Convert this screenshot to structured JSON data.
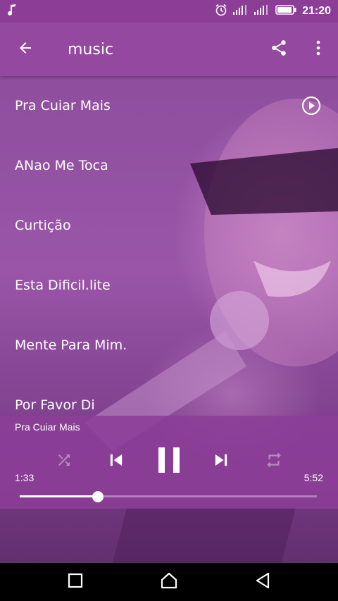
{
  "status_bar": {
    "time": "21:20",
    "icons": [
      "music-note-icon",
      "alarm-icon",
      "signal-icon",
      "signal-icon",
      "battery-icon"
    ]
  },
  "app_bar": {
    "title": "music",
    "icons": [
      "back-arrow-icon",
      "share-icon",
      "more-vert-icon"
    ]
  },
  "songs": [
    {
      "title": "Pra Cuiar Mais",
      "playing": true
    },
    {
      "title": "ANao Me Toca"
    },
    {
      "title": "Curtição"
    },
    {
      "title": "Esta Dificil.lite"
    },
    {
      "title": "Mente Para Mim."
    },
    {
      "title": "Por Favor Di"
    }
  ],
  "player": {
    "now_playing": "Pra Cuiar Mais",
    "elapsed": "1:33",
    "duration": "5:52",
    "progress": 0.264,
    "icons": [
      "shuffle-icon",
      "previous-icon",
      "pause-icon",
      "next-icon",
      "repeat-icon"
    ]
  },
  "nav_bar": {
    "icons": [
      "recents-icon",
      "home-icon",
      "back-icon"
    ]
  },
  "colors": {
    "accent": "#8c3e97",
    "nav_background": "#000000"
  }
}
